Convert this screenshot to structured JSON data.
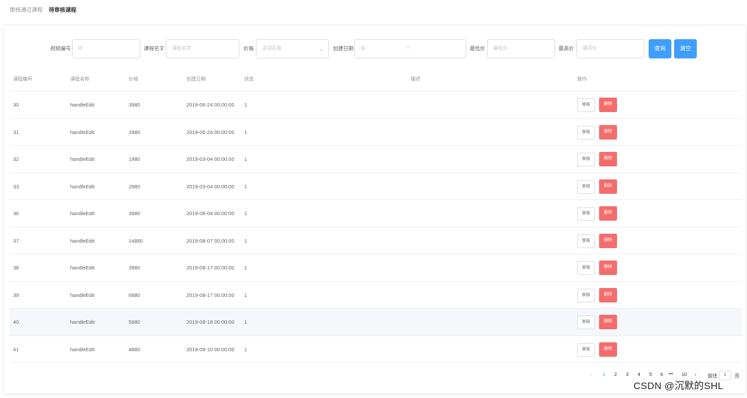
{
  "tabs": {
    "approved": "审核通过课程",
    "pending": "待审核课程"
  },
  "filters": {
    "video_id_label": "视频编号",
    "video_id_placeholder": "id",
    "course_name_label": "课程名字",
    "course_name_placeholder": "课程名字",
    "price_label": "价格",
    "price_placeholder": "活动区域",
    "created_label": "创建日期",
    "created_placeholder": "自",
    "created_separator": "-",
    "min_price_label": "最低价",
    "min_price_placeholder": "最低价",
    "max_price_label": "最高价",
    "max_price_placeholder": "最高价",
    "search_button": "查询",
    "clear_button": "清空"
  },
  "table": {
    "headers": {
      "id": "课程编号",
      "name": "课程名称",
      "price": "价格",
      "date": "创建日期",
      "status": "状态",
      "desc": "描述",
      "ops": "操作"
    },
    "action_audit": "审核",
    "action_delete": "删除",
    "rows": [
      {
        "id": "30",
        "name": "handleEdit",
        "price": "3980",
        "date": "2019-06-24 00:00:00",
        "status": "1"
      },
      {
        "id": "31",
        "name": "handleEdit",
        "price": "2980",
        "date": "2019-06-24 00:00:00",
        "status": "1"
      },
      {
        "id": "32",
        "name": "handleEdit",
        "price": "1980",
        "date": "2019-03-04 00:00:00",
        "status": "1"
      },
      {
        "id": "33",
        "name": "handleEdit",
        "price": "2980",
        "date": "2019-03-04 00:00:00",
        "status": "1"
      },
      {
        "id": "36",
        "name": "handleEdit",
        "price": "3980",
        "date": "2019-08-04 00:00:00",
        "status": "1"
      },
      {
        "id": "37",
        "name": "handleEdit",
        "price": "14880",
        "date": "2019-08-07 00:00:00",
        "status": "1"
      },
      {
        "id": "38",
        "name": "handleEdit",
        "price": "3980",
        "date": "2019-08-17 00:00:00",
        "status": "1"
      },
      {
        "id": "39",
        "name": "handleEdit",
        "price": "6980",
        "date": "2019-08-17 00:00:00",
        "status": "1"
      },
      {
        "id": "40",
        "name": "handleEdit",
        "price": "5980",
        "date": "2019-08-18 00:00:00",
        "status": "1"
      },
      {
        "id": "41",
        "name": "handleEdit",
        "price": "4880",
        "date": "2019-09-10 00:00:00",
        "status": "1"
      }
    ]
  },
  "pagination": {
    "prev": "‹",
    "next": "›",
    "pages": [
      "1",
      "2",
      "3",
      "4",
      "5",
      "6"
    ],
    "ellipsis": "•••",
    "last": "10",
    "goto_prefix": "前往",
    "goto_value": "1",
    "goto_suffix": "页"
  },
  "watermark": "CSDN @沉默的SHL",
  "colors": {
    "primary": "#409eff",
    "danger": "#f56c6c",
    "border": "#dcdfe6",
    "highlight_row": "#f5f7fa"
  }
}
